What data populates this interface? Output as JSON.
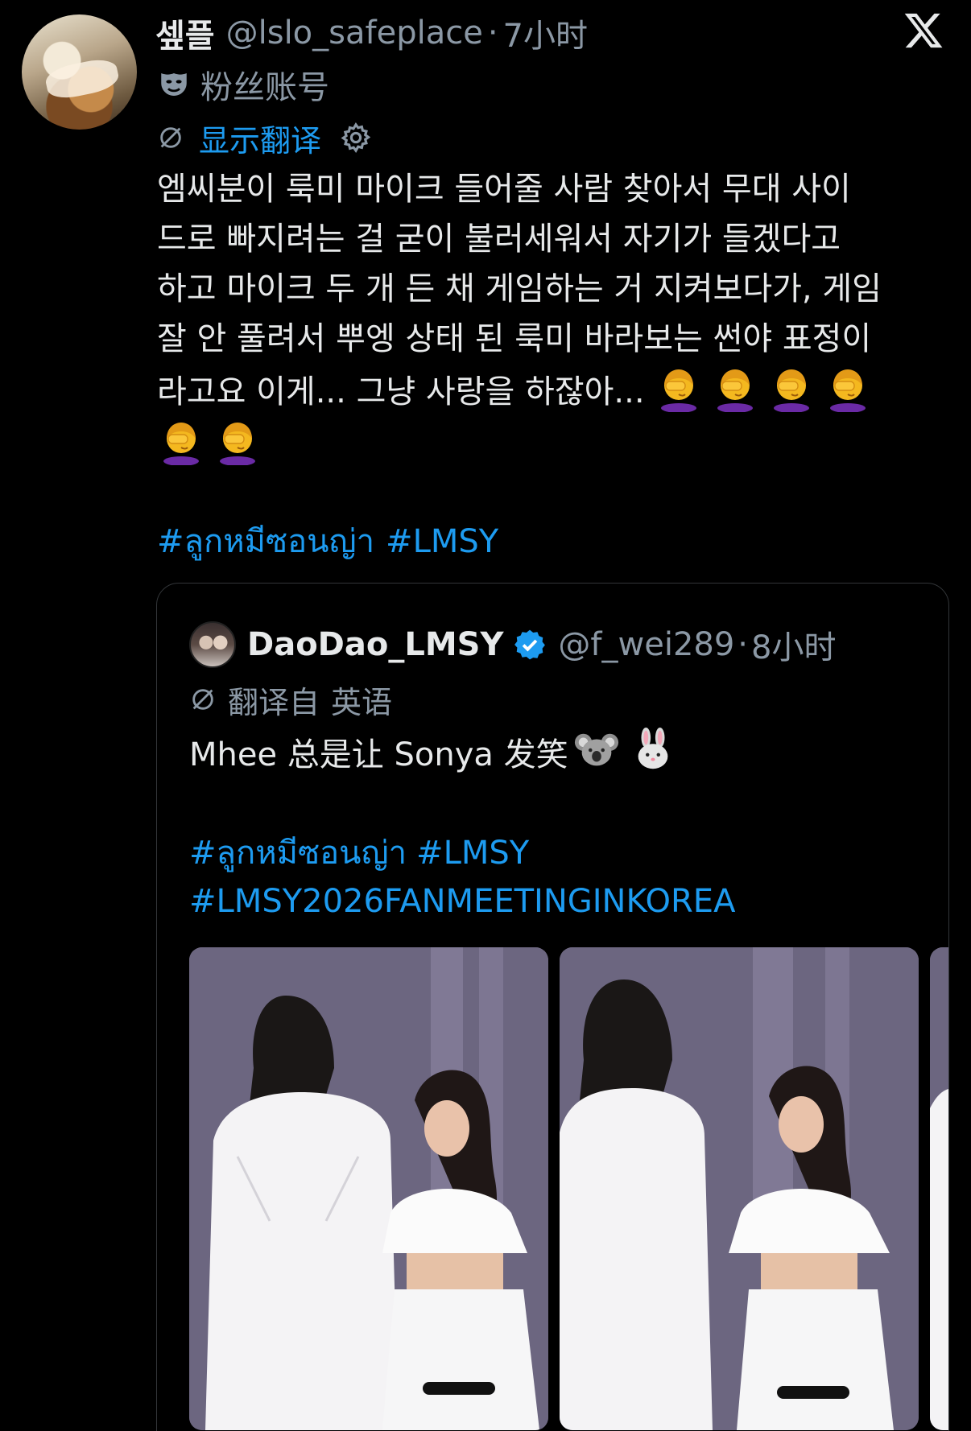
{
  "tweet": {
    "author_name": "셒플",
    "handle": "@lslo_safeplace",
    "separator": "·",
    "time": "7小时",
    "account_label": "粉丝账号",
    "translate_label": "显示翻译",
    "body": "엠씨분이 룩미 마이크 들어줄 사람 찾아서 무대 사이\n드로 빠지려는 걸 굳이 불러세워서 자기가 들겠다고\n하고 마이크 두 개 든 채 게임하는 거 지켜보다가, 게임\n잘 안 풀려서 뿌엥 상태 된 룩미 바라보는 썬야 표정이\n라고요 이게... 그냥 사랑을 하잖아... ",
    "hashtags": [
      "#ลูกหมีซอนญ่า",
      "#LMSY"
    ],
    "emojis": [
      "face-palm-emoji",
      "face-palm-emoji",
      "face-palm-emoji",
      "face-palm-emoji",
      "face-palm-emoji",
      "face-palm-emoji"
    ]
  },
  "quote": {
    "author_name": "DaoDao_LMSY",
    "handle": "@f_wei289",
    "separator": "·",
    "time": "8小时",
    "translated_label": "翻译自",
    "source_language": "英语",
    "body_text": "Mhee 总是让 Sonya 发笑",
    "emojis": [
      "koala-emoji",
      "rabbit-emoji"
    ],
    "hashtags": [
      "#ลูกหมีซอนญ่า",
      "#LMSY",
      "#LMSY2026FANMEETINGINKOREA"
    ]
  },
  "colors": {
    "background": "#000000",
    "text": "#e7e9ea",
    "secondary": "#8b98a5",
    "accent": "#1d9bf0",
    "border": "#333639"
  },
  "icons": [
    "x-logo-icon",
    "mask-icon",
    "translate-icon",
    "gear-icon",
    "verified-badge-icon"
  ]
}
